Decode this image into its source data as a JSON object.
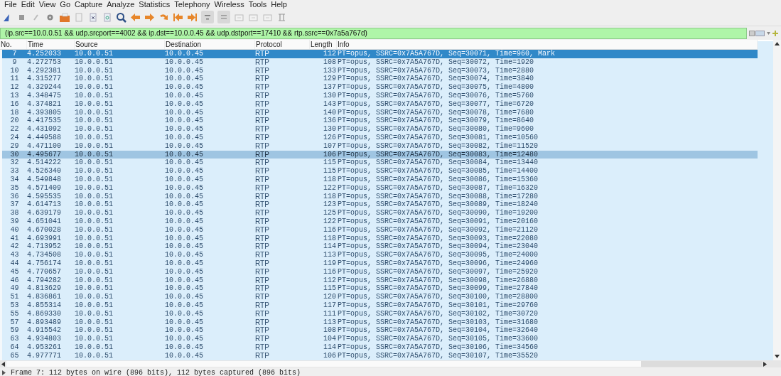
{
  "menu": [
    "File",
    "Edit",
    "View",
    "Go",
    "Capture",
    "Analyze",
    "Statistics",
    "Telephony",
    "Wireless",
    "Tools",
    "Help"
  ],
  "filter": {
    "value": "(ip.src==10.0.0.51 && udp.srcport==4002 && ip.dst==10.0.0.45 && udp.dstport==17410 && rtp.ssrc==0x7a5a767d)"
  },
  "columns": [
    "No.",
    "Time",
    "Source",
    "Destination",
    "Protocol",
    "Length",
    "Info"
  ],
  "rows": [
    {
      "no": "7",
      "time": "4.252033",
      "source": "10.0.0.51",
      "destination": "10.0.0.45",
      "protocol": "RTP",
      "length": "112",
      "info": "PT=opus, SSRC=0x7A5A767D, Seq=30071, Time=960, Mark",
      "selected": true,
      "hovered": false
    },
    {
      "no": "9",
      "time": "4.272753",
      "source": "10.0.0.51",
      "destination": "10.0.0.45",
      "protocol": "RTP",
      "length": "108",
      "info": "PT=opus, SSRC=0x7A5A767D, Seq=30072, Time=1920",
      "selected": false,
      "hovered": false
    },
    {
      "no": "10",
      "time": "4.292381",
      "source": "10.0.0.51",
      "destination": "10.0.0.45",
      "protocol": "RTP",
      "length": "133",
      "info": "PT=opus, SSRC=0x7A5A767D, Seq=30073, Time=2880",
      "selected": false,
      "hovered": false
    },
    {
      "no": "11",
      "time": "4.315277",
      "source": "10.0.0.51",
      "destination": "10.0.0.45",
      "protocol": "RTP",
      "length": "129",
      "info": "PT=opus, SSRC=0x7A5A767D, Seq=30074, Time=3840",
      "selected": false,
      "hovered": false
    },
    {
      "no": "12",
      "time": "4.329244",
      "source": "10.0.0.51",
      "destination": "10.0.0.45",
      "protocol": "RTP",
      "length": "137",
      "info": "PT=opus, SSRC=0x7A5A767D, Seq=30075, Time=4800",
      "selected": false,
      "hovered": false
    },
    {
      "no": "13",
      "time": "4.348475",
      "source": "10.0.0.51",
      "destination": "10.0.0.45",
      "protocol": "RTP",
      "length": "130",
      "info": "PT=opus, SSRC=0x7A5A767D, Seq=30076, Time=5760",
      "selected": false,
      "hovered": false
    },
    {
      "no": "16",
      "time": "4.374821",
      "source": "10.0.0.51",
      "destination": "10.0.0.45",
      "protocol": "RTP",
      "length": "143",
      "info": "PT=opus, SSRC=0x7A5A767D, Seq=30077, Time=6720",
      "selected": false,
      "hovered": false
    },
    {
      "no": "18",
      "time": "4.393805",
      "source": "10.0.0.51",
      "destination": "10.0.0.45",
      "protocol": "RTP",
      "length": "140",
      "info": "PT=opus, SSRC=0x7A5A767D, Seq=30078, Time=7680",
      "selected": false,
      "hovered": false
    },
    {
      "no": "20",
      "time": "4.417535",
      "source": "10.0.0.51",
      "destination": "10.0.0.45",
      "protocol": "RTP",
      "length": "136",
      "info": "PT=opus, SSRC=0x7A5A767D, Seq=30079, Time=8640",
      "selected": false,
      "hovered": false
    },
    {
      "no": "22",
      "time": "4.431092",
      "source": "10.0.0.51",
      "destination": "10.0.0.45",
      "protocol": "RTP",
      "length": "130",
      "info": "PT=opus, SSRC=0x7A5A767D, Seq=30080, Time=9600",
      "selected": false,
      "hovered": false
    },
    {
      "no": "24",
      "time": "4.449588",
      "source": "10.0.0.51",
      "destination": "10.0.0.45",
      "protocol": "RTP",
      "length": "126",
      "info": "PT=opus, SSRC=0x7A5A767D, Seq=30081, Time=10560",
      "selected": false,
      "hovered": false
    },
    {
      "no": "29",
      "time": "4.471100",
      "source": "10.0.0.51",
      "destination": "10.0.0.45",
      "protocol": "RTP",
      "length": "107",
      "info": "PT=opus, SSRC=0x7A5A767D, Seq=30082, Time=11520",
      "selected": false,
      "hovered": false
    },
    {
      "no": "30",
      "time": "4.495677",
      "source": "10.0.0.51",
      "destination": "10.0.0.45",
      "protocol": "RTP",
      "length": "106",
      "info": "PT=opus, SSRC=0x7A5A767D, Seq=30083, Time=12480",
      "selected": false,
      "hovered": true
    },
    {
      "no": "32",
      "time": "4.514222",
      "source": "10.0.0.51",
      "destination": "10.0.0.45",
      "protocol": "RTP",
      "length": "115",
      "info": "PT=opus, SSRC=0x7A5A767D, Seq=30084, Time=13440",
      "selected": false,
      "hovered": false
    },
    {
      "no": "33",
      "time": "4.526340",
      "source": "10.0.0.51",
      "destination": "10.0.0.45",
      "protocol": "RTP",
      "length": "115",
      "info": "PT=opus, SSRC=0x7A5A767D, Seq=30085, Time=14400",
      "selected": false,
      "hovered": false
    },
    {
      "no": "34",
      "time": "4.549848",
      "source": "10.0.0.51",
      "destination": "10.0.0.45",
      "protocol": "RTP",
      "length": "118",
      "info": "PT=opus, SSRC=0x7A5A767D, Seq=30086, Time=15360",
      "selected": false,
      "hovered": false
    },
    {
      "no": "35",
      "time": "4.571409",
      "source": "10.0.0.51",
      "destination": "10.0.0.45",
      "protocol": "RTP",
      "length": "122",
      "info": "PT=opus, SSRC=0x7A5A767D, Seq=30087, Time=16320",
      "selected": false,
      "hovered": false
    },
    {
      "no": "36",
      "time": "4.595535",
      "source": "10.0.0.51",
      "destination": "10.0.0.45",
      "protocol": "RTP",
      "length": "118",
      "info": "PT=opus, SSRC=0x7A5A767D, Seq=30088, Time=17280",
      "selected": false,
      "hovered": false
    },
    {
      "no": "37",
      "time": "4.614713",
      "source": "10.0.0.51",
      "destination": "10.0.0.45",
      "protocol": "RTP",
      "length": "123",
      "info": "PT=opus, SSRC=0x7A5A767D, Seq=30089, Time=18240",
      "selected": false,
      "hovered": false
    },
    {
      "no": "38",
      "time": "4.639179",
      "source": "10.0.0.51",
      "destination": "10.0.0.45",
      "protocol": "RTP",
      "length": "125",
      "info": "PT=opus, SSRC=0x7A5A767D, Seq=30090, Time=19200",
      "selected": false,
      "hovered": false
    },
    {
      "no": "39",
      "time": "4.651041",
      "source": "10.0.0.51",
      "destination": "10.0.0.45",
      "protocol": "RTP",
      "length": "122",
      "info": "PT=opus, SSRC=0x7A5A767D, Seq=30091, Time=20160",
      "selected": false,
      "hovered": false
    },
    {
      "no": "40",
      "time": "4.670028",
      "source": "10.0.0.51",
      "destination": "10.0.0.45",
      "protocol": "RTP",
      "length": "116",
      "info": "PT=opus, SSRC=0x7A5A767D, Seq=30092, Time=21120",
      "selected": false,
      "hovered": false
    },
    {
      "no": "41",
      "time": "4.693991",
      "source": "10.0.0.51",
      "destination": "10.0.0.45",
      "protocol": "RTP",
      "length": "118",
      "info": "PT=opus, SSRC=0x7A5A767D, Seq=30093, Time=22080",
      "selected": false,
      "hovered": false
    },
    {
      "no": "42",
      "time": "4.713952",
      "source": "10.0.0.51",
      "destination": "10.0.0.45",
      "protocol": "RTP",
      "length": "114",
      "info": "PT=opus, SSRC=0x7A5A767D, Seq=30094, Time=23040",
      "selected": false,
      "hovered": false
    },
    {
      "no": "43",
      "time": "4.734508",
      "source": "10.0.0.51",
      "destination": "10.0.0.45",
      "protocol": "RTP",
      "length": "113",
      "info": "PT=opus, SSRC=0x7A5A767D, Seq=30095, Time=24000",
      "selected": false,
      "hovered": false
    },
    {
      "no": "44",
      "time": "4.756174",
      "source": "10.0.0.51",
      "destination": "10.0.0.45",
      "protocol": "RTP",
      "length": "119",
      "info": "PT=opus, SSRC=0x7A5A767D, Seq=30096, Time=24960",
      "selected": false,
      "hovered": false
    },
    {
      "no": "45",
      "time": "4.770657",
      "source": "10.0.0.51",
      "destination": "10.0.0.45",
      "protocol": "RTP",
      "length": "116",
      "info": "PT=opus, SSRC=0x7A5A767D, Seq=30097, Time=25920",
      "selected": false,
      "hovered": false
    },
    {
      "no": "46",
      "time": "4.794282",
      "source": "10.0.0.51",
      "destination": "10.0.0.45",
      "protocol": "RTP",
      "length": "112",
      "info": "PT=opus, SSRC=0x7A5A767D, Seq=30098, Time=26880",
      "selected": false,
      "hovered": false
    },
    {
      "no": "49",
      "time": "4.813629",
      "source": "10.0.0.51",
      "destination": "10.0.0.45",
      "protocol": "RTP",
      "length": "115",
      "info": "PT=opus, SSRC=0x7A5A767D, Seq=30099, Time=27840",
      "selected": false,
      "hovered": false
    },
    {
      "no": "51",
      "time": "4.836861",
      "source": "10.0.0.51",
      "destination": "10.0.0.45",
      "protocol": "RTP",
      "length": "120",
      "info": "PT=opus, SSRC=0x7A5A767D, Seq=30100, Time=28800",
      "selected": false,
      "hovered": false
    },
    {
      "no": "53",
      "time": "4.855314",
      "source": "10.0.0.51",
      "destination": "10.0.0.45",
      "protocol": "RTP",
      "length": "117",
      "info": "PT=opus, SSRC=0x7A5A767D, Seq=30101, Time=29760",
      "selected": false,
      "hovered": false
    },
    {
      "no": "55",
      "time": "4.869330",
      "source": "10.0.0.51",
      "destination": "10.0.0.45",
      "protocol": "RTP",
      "length": "111",
      "info": "PT=opus, SSRC=0x7A5A767D, Seq=30102, Time=30720",
      "selected": false,
      "hovered": false
    },
    {
      "no": "57",
      "time": "4.893489",
      "source": "10.0.0.51",
      "destination": "10.0.0.45",
      "protocol": "RTP",
      "length": "113",
      "info": "PT=opus, SSRC=0x7A5A767D, Seq=30103, Time=31680",
      "selected": false,
      "hovered": false
    },
    {
      "no": "59",
      "time": "4.915542",
      "source": "10.0.0.51",
      "destination": "10.0.0.45",
      "protocol": "RTP",
      "length": "108",
      "info": "PT=opus, SSRC=0x7A5A767D, Seq=30104, Time=32640",
      "selected": false,
      "hovered": false
    },
    {
      "no": "63",
      "time": "4.934803",
      "source": "10.0.0.51",
      "destination": "10.0.0.45",
      "protocol": "RTP",
      "length": "104",
      "info": "PT=opus, SSRC=0x7A5A767D, Seq=30105, Time=33600",
      "selected": false,
      "hovered": false
    },
    {
      "no": "64",
      "time": "4.953261",
      "source": "10.0.0.51",
      "destination": "10.0.0.45",
      "protocol": "RTP",
      "length": "114",
      "info": "PT=opus, SSRC=0x7A5A767D, Seq=30106, Time=34560",
      "selected": false,
      "hovered": false
    },
    {
      "no": "65",
      "time": "4.977771",
      "source": "10.0.0.51",
      "destination": "10.0.0.45",
      "protocol": "RTP",
      "length": "106",
      "info": "PT=opus, SSRC=0x7A5A767D, Seq=30107, Time=35520",
      "selected": false,
      "hovered": false
    }
  ],
  "status_bar": {
    "text": "Frame 7: 112 bytes on wire (896 bits), 112 bytes captured (896 bits)"
  }
}
